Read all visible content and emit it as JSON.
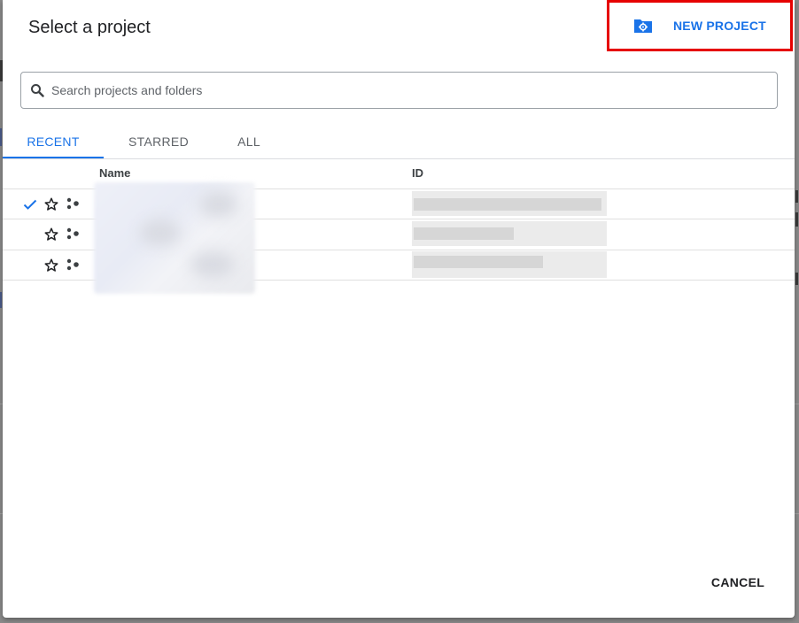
{
  "dialog": {
    "title": "Select a project",
    "new_project_label": "NEW PROJECT",
    "new_project_icon": "folder-settings-icon",
    "cancel_label": "CANCEL"
  },
  "search": {
    "placeholder": "Search projects and folders",
    "icon": "search-icon",
    "value": ""
  },
  "tabs": [
    {
      "label": "RECENT",
      "active": true
    },
    {
      "label": "STARRED",
      "active": false
    },
    {
      "label": "ALL",
      "active": false
    }
  ],
  "table": {
    "columns": [
      "Name",
      "ID"
    ],
    "rows": [
      {
        "selected": true,
        "starred": false,
        "name": "",
        "id": ""
      },
      {
        "selected": false,
        "starred": false,
        "name": "",
        "id": ""
      },
      {
        "selected": false,
        "starred": false,
        "name": "",
        "id": ""
      }
    ]
  },
  "colors": {
    "accent": "#1a73e8",
    "highlight_box": "#e60000",
    "text": "#202124"
  }
}
